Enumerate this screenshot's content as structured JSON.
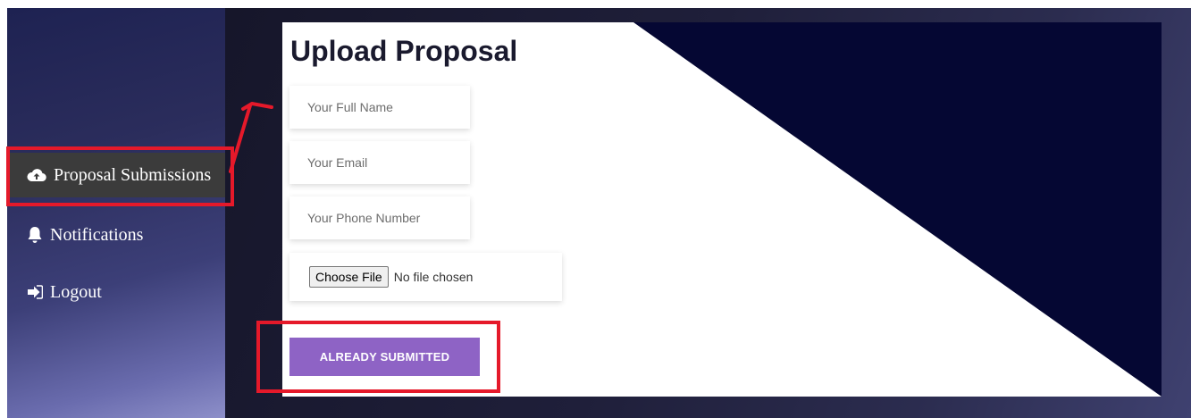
{
  "sidebar": {
    "items": [
      {
        "label": "Proposal Submissions",
        "icon": "cloud-upload-icon",
        "active": true
      },
      {
        "label": "Notifications",
        "icon": "bell-icon",
        "active": false
      },
      {
        "label": "Logout",
        "icon": "logout-icon",
        "active": false
      }
    ]
  },
  "main": {
    "title": "Upload Proposal",
    "form": {
      "name_placeholder": "Your Full Name",
      "email_placeholder": "Your Email",
      "phone_placeholder": "Your Phone Number",
      "file_button_label": "Choose File",
      "file_status": "No file chosen",
      "submit_label": "ALREADY SUBMITTED"
    }
  },
  "colors": {
    "sidebar_active_bg": "#3b3b3b",
    "accent_button": "#8e63c5",
    "triangle_navy": "#050733",
    "annotation_red": "#e5192a"
  }
}
